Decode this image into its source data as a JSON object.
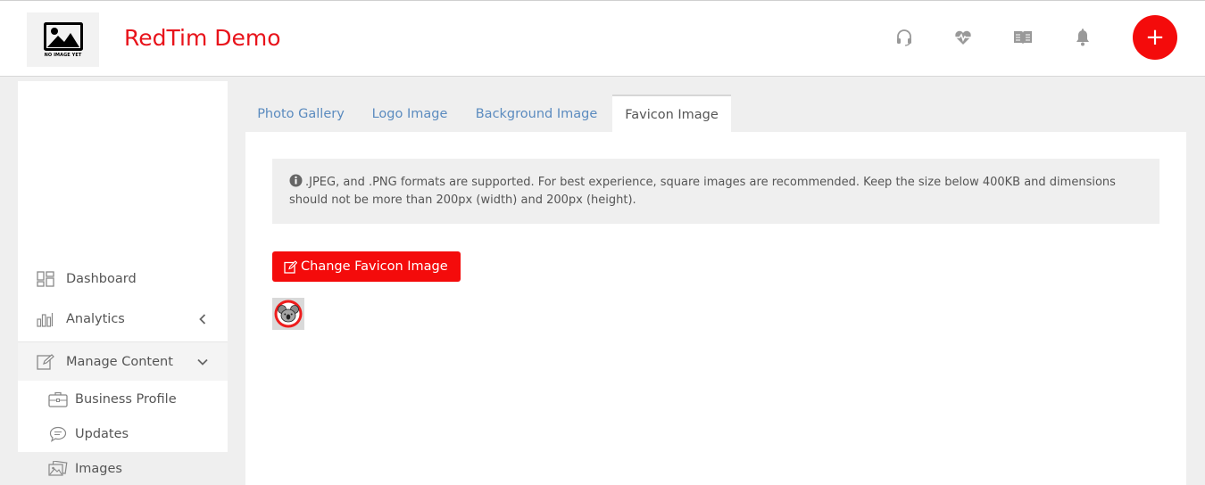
{
  "header": {
    "logo_caption": "NO IMAGE YET",
    "brand": "RedTim Demo",
    "icons": [
      "headset-icon",
      "heart-pulse-icon",
      "book-icon",
      "bell-icon"
    ],
    "add_button": "+",
    "accent_color": "#f40b0b",
    "brand_color": "#e8131b"
  },
  "sidebar": {
    "items": [
      {
        "label": "Dashboard",
        "icon": "dashboard-icon"
      },
      {
        "label": "Analytics",
        "icon": "bar-chart-icon"
      },
      {
        "label": "Manage Content",
        "icon": "edit-icon"
      }
    ],
    "sub_items": [
      {
        "label": "Business Profile",
        "icon": "briefcase-icon"
      },
      {
        "label": "Updates",
        "icon": "chat-bubble-icon"
      },
      {
        "label": "Images",
        "icon": "images-icon"
      }
    ]
  },
  "tabs": [
    {
      "label": "Photo Gallery"
    },
    {
      "label": "Logo Image"
    },
    {
      "label": "Background Image"
    },
    {
      "label": "Favicon Image",
      "active": true
    }
  ],
  "content": {
    "notice": ".JPEG, and .PNG formats are supported. For best experience, square images are recommended. Keep the size below 400KB and dimensions should not be more than 200px (width) and 200px (height).",
    "change_button": "Change Favicon Image"
  }
}
